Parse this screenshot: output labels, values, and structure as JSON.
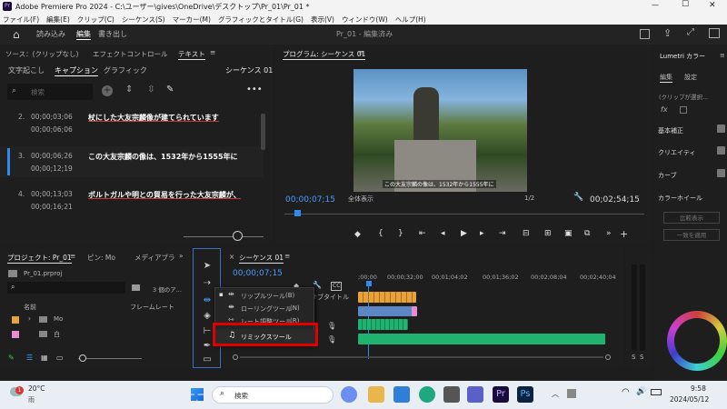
{
  "titlebar": {
    "title": "Adobe Premiere Pro 2024 - C:\\ユーザー\\gives\\OneDrive\\デスクトップ\\Pr_01\\Pr_01 *",
    "app_icon": "Pr",
    "min": "—",
    "max": "☐",
    "close": "✕"
  },
  "menu": [
    "ファイル(F)",
    "編集(E)",
    "クリップ(C)",
    "シーケンス(S)",
    "マーカー(M)",
    "グラフィックとタイトル(G)",
    "表示(V)",
    "ウィンドウ(W)",
    "ヘルプ(H)"
  ],
  "workspace": {
    "tabs": [
      "読み込み",
      "編集",
      "書き出し"
    ],
    "active": "編集",
    "center": "Pr_01 - 編集済み"
  },
  "source_panel": {
    "tabs": [
      "ソース：(クリップなし)",
      "エフェクトコントロール",
      "テキスト"
    ],
    "menu": "≡"
  },
  "text_panel": {
    "subtabs": [
      "文字起こし",
      "キャプション",
      "グラフィック"
    ],
    "active": "キャプション",
    "sequence": "シーケンス 01",
    "search_placeholder": "検索",
    "captions": [
      {
        "n": "2.",
        "in": "00;00;03;06",
        "out": "00;00;06;06",
        "text": "杖にした大友宗麟像が建てられています",
        "active": false,
        "underline": true
      },
      {
        "n": "3.",
        "in": "00;00;06;26",
        "out": "00;00;12;19",
        "text": "この大友宗麟の像は、1532年から1555年に",
        "active": true,
        "underline": false
      },
      {
        "n": "4.",
        "in": "00;00;13;03",
        "out": "00;00;16;21",
        "text": "ポルトガルや明との貿易を行った大友宗麟が、",
        "active": false,
        "underline": true
      }
    ]
  },
  "program": {
    "title": "プログラム: シーケンス 01",
    "menu": "≡",
    "subtitle": "この大友宗麟の像は、1532年から1555年に",
    "timecode": "00;00;07;15",
    "fit": "全体表示",
    "quality": "1/2",
    "duration": "00;02;54;15"
  },
  "lumetri": {
    "title": "Lumetri カラー",
    "menu": "≡",
    "tabs": [
      "編集",
      "設定"
    ],
    "clip_text": "(クリップが選択...",
    "fx": "fx",
    "sections": [
      "基本補正",
      "クリエイティ",
      "カーブ",
      "カラーホイール"
    ],
    "buttons": [
      "比較表示",
      "一致を適用"
    ]
  },
  "project": {
    "title": "プロジェクト: Pr_01",
    "menu": "≡",
    "tabs": [
      "ピン: Mo",
      "メディアブラ"
    ],
    "file": "Pr_01.prproj",
    "count": "3 個のア...",
    "col_name": "名前",
    "col_rate": "フレームレート",
    "items": [
      "Mo",
      "白"
    ]
  },
  "timeline": {
    "close": "×",
    "title": "シーケンス 01",
    "menu": "≡",
    "timecode": "00;00;07;15",
    "ruler": [
      ";00;00",
      "00;00;32;00",
      "00;01;04;02",
      "00;01;36;02",
      "00;02;08;04",
      "00;02;40;04"
    ],
    "subtitle_label": "サブタイトル",
    "meters": [
      "S",
      "S"
    ]
  },
  "popup": {
    "items": [
      {
        "label": "リップルツール",
        "key": "(B)",
        "selected": true
      },
      {
        "label": "ローリングツール",
        "key": "(N)",
        "selected": false
      },
      {
        "label": "レート調整ツール",
        "key": "(R)",
        "selected": false
      },
      {
        "label": "リミックスツール",
        "key": "",
        "selected": false
      }
    ]
  },
  "taskbar": {
    "temp": "20°C",
    "weather": "雨",
    "badge": "1",
    "search": "検索",
    "time": "9:58",
    "date": "2024/05/12"
  },
  "colors": {
    "accent": "#2d8ceb",
    "highlight_box": "#e00000",
    "video_clip": "#e8a23a",
    "audio_clip": "#1fb36f",
    "caption_clip": "#5b87c7",
    "pink": "#e88bd0"
  }
}
